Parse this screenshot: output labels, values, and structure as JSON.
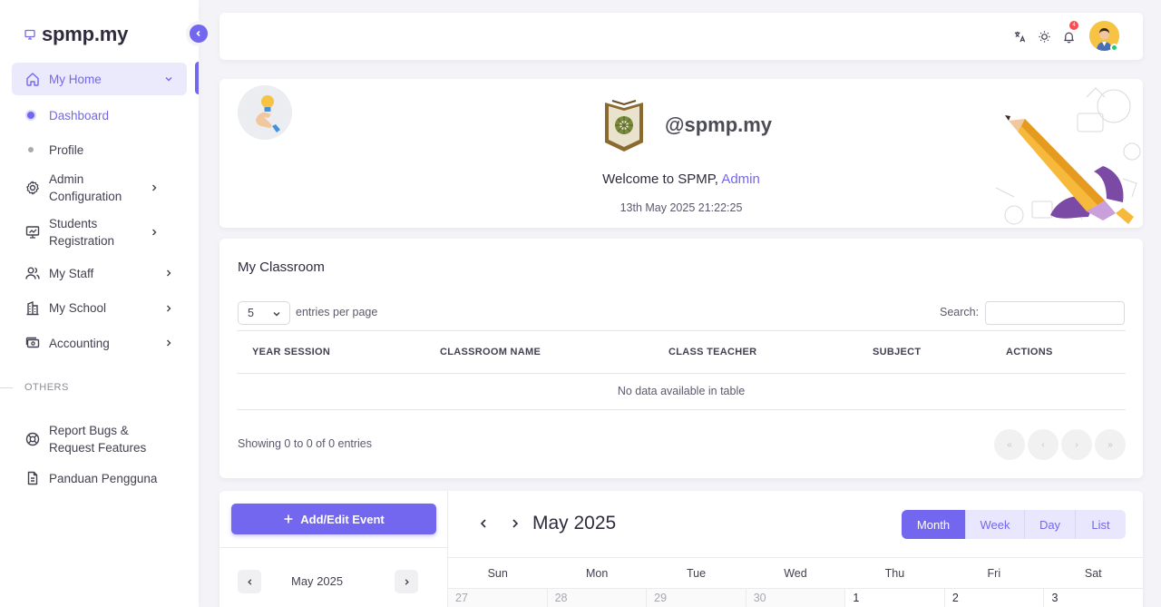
{
  "brand": {
    "name": "spmp.my",
    "logo_icon": "monitor-icon"
  },
  "sidebar": {
    "home": {
      "label": "My Home"
    },
    "sub_items": [
      {
        "label": "Dashboard",
        "active": true
      },
      {
        "label": "Profile",
        "active": false
      }
    ],
    "items": [
      {
        "label": "Admin Configuration",
        "icon": "gear-icon"
      },
      {
        "label": "Students Registration",
        "icon": "presentation-icon"
      },
      {
        "label": "My Staff",
        "icon": "users-icon"
      },
      {
        "label": "My School",
        "icon": "building-icon"
      },
      {
        "label": "Accounting",
        "icon": "cash-icon"
      }
    ],
    "section_label": "OTHERS",
    "others": [
      {
        "label": "Report Bugs & Request Features",
        "icon": "lifebuoy-icon"
      },
      {
        "label": "Panduan Pengguna",
        "icon": "document-icon"
      }
    ]
  },
  "topbar": {
    "notification_count": "4"
  },
  "welcome": {
    "handle": "@spmp.my",
    "greeting": "Welcome to SPMP,",
    "user": "Admin",
    "datetime": "13th May 2025 21:22:25"
  },
  "classroom": {
    "title": "My Classroom",
    "per_page_value": "5",
    "per_page_label": "entries per page",
    "search_label": "Search:",
    "columns": [
      "YEAR SESSION",
      "CLASSROOM NAME",
      "CLASS TEACHER",
      "SUBJECT",
      "ACTIONS"
    ],
    "empty_text": "No data available in table",
    "showing": "Showing 0 to 0 of 0 entries",
    "pager": [
      "«",
      "‹",
      "›",
      "»"
    ]
  },
  "calendar": {
    "add_event": "Add/Edit Event",
    "mini_month": "May",
    "mini_year": "2025",
    "title": "May 2025",
    "views": [
      "Month",
      "Week",
      "Day",
      "List"
    ],
    "active_view": "Month",
    "weekdays": [
      "Sun",
      "Mon",
      "Tue",
      "Wed",
      "Thu",
      "Fri",
      "Sat"
    ],
    "first_row": [
      "27",
      "28",
      "29",
      "30",
      "1",
      "2",
      "3"
    ]
  },
  "colors": {
    "primary": "#7367f0",
    "danger": "#ff4c51",
    "success": "#28c76f"
  }
}
